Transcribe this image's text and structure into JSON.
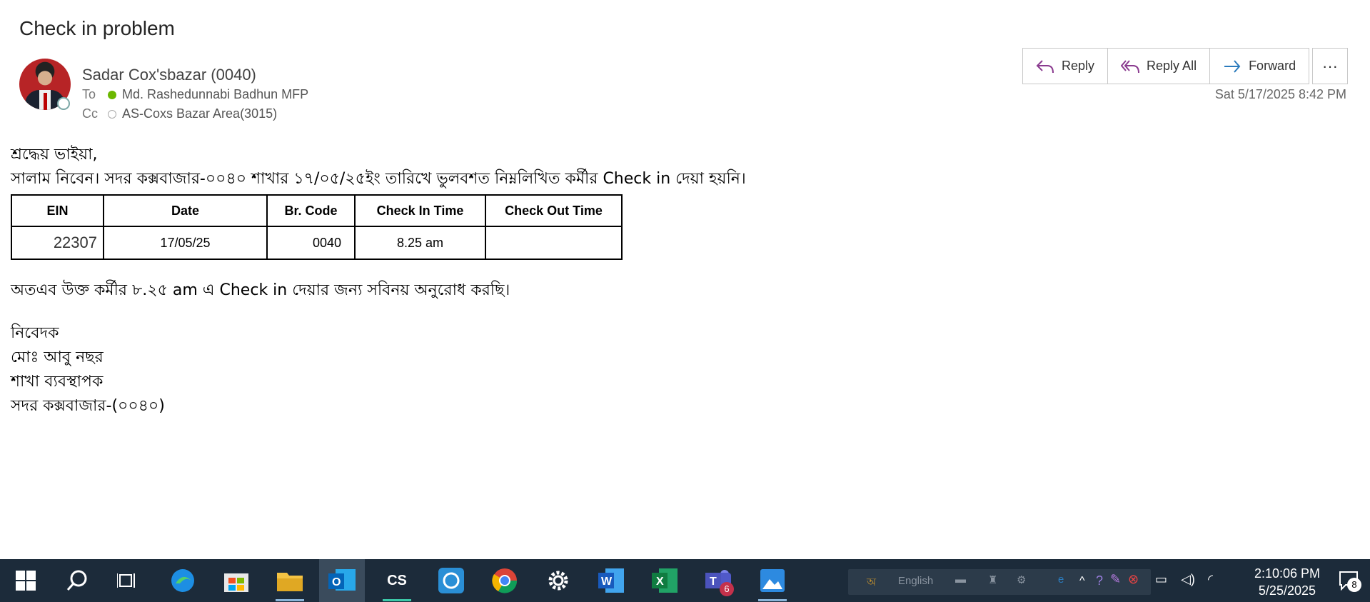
{
  "email": {
    "subject": "Check in problem",
    "sender": "Sadar Cox'sbazar (0040)",
    "to_label": "To",
    "to": "Md. Rashedunnabi Badhun MFP",
    "cc_label": "Cc",
    "cc": "AS-Coxs Bazar Area(3015)",
    "date": "Sat 5/17/2025 8:42 PM",
    "actions": {
      "reply": "Reply",
      "reply_all": "Reply All",
      "forward": "Forward",
      "more": "···"
    }
  },
  "body": {
    "greeting": "শ্রদ্ধেয় ভাইয়া,",
    "intro": "সালাম নিবেন। সদর কক্সবাজার-০০৪০ শাখার ১৭/০৫/২৫ইং তারিখে ভুলবশত নিম্নলিখিত কর্মীর Check in দেয়া হয়নি।",
    "table": {
      "headers": [
        "EIN",
        "Date",
        "Br. Code",
        "Check In Time",
        "Check Out Time"
      ],
      "row": [
        "22307",
        "17/05/25",
        "0040",
        "8.25 am",
        ""
      ]
    },
    "request": "অতএব উক্ত কর্মীর ৮.২৫ am এ Check in দেয়ার জন্য সবিনয় অনুরোধ করছি।",
    "signature": [
      "নিবেদক",
      "মোঃ আবু নছর",
      "শাখা ব্যবস্থাপক",
      "সদর কক্সবাজার-(০০৪০)"
    ]
  },
  "taskbar": {
    "language": "English",
    "time": "2:10:06 PM",
    "date": "5/25/2025",
    "teams_badge": "6",
    "notifications": "8",
    "cs_label": "CS"
  }
}
